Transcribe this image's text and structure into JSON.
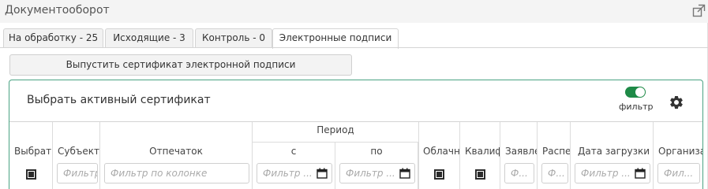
{
  "header": {
    "title": "Документооборот"
  },
  "tabs": [
    {
      "label": "На обработку - 25"
    },
    {
      "label": "Исходящие - 3"
    },
    {
      "label": "Контроль - 0"
    },
    {
      "label": "Электронные подписи"
    }
  ],
  "actions": {
    "issue_certificate": "Выпустить сертификат электронной подписи"
  },
  "cert_panel": {
    "title": "Выбрать активный сертификат",
    "filter_label": "фильтр",
    "filter_on": true,
    "accent_color": "#1e8a47"
  },
  "table": {
    "period_group": "Период",
    "columns": {
      "select": "Выбрать",
      "subject": "Субъект",
      "fingerprint": "Отпечаток",
      "from": "с",
      "to": "по",
      "cloud": "Облачный",
      "qualified": "Квалифицированный",
      "request": "Заявление",
      "distribution": "Распечатка",
      "upload_date": "Дата загрузки",
      "organization": "Организация"
    },
    "filters": {
      "subject": "Фильтр по колонке",
      "fingerprint": "Фильтр по колонке",
      "from": "Фильтр по колонке",
      "to": "Фильтр по колонке",
      "request": "Фильтр по колонке",
      "distribution": "Фильтр по колонке",
      "upload_date": "Фильтр по колонке",
      "organization": "Фильтр по колонке"
    },
    "filters_display": {
      "subject": "Фильтр",
      "fingerprint": "Фильтр по колонке",
      "from": "Фильтр ...",
      "to": "Фильтр ...",
      "request": "Ф...",
      "distribution": "Ф...",
      "upload_date": "Фильтр ...",
      "organization": "Фил..."
    }
  }
}
